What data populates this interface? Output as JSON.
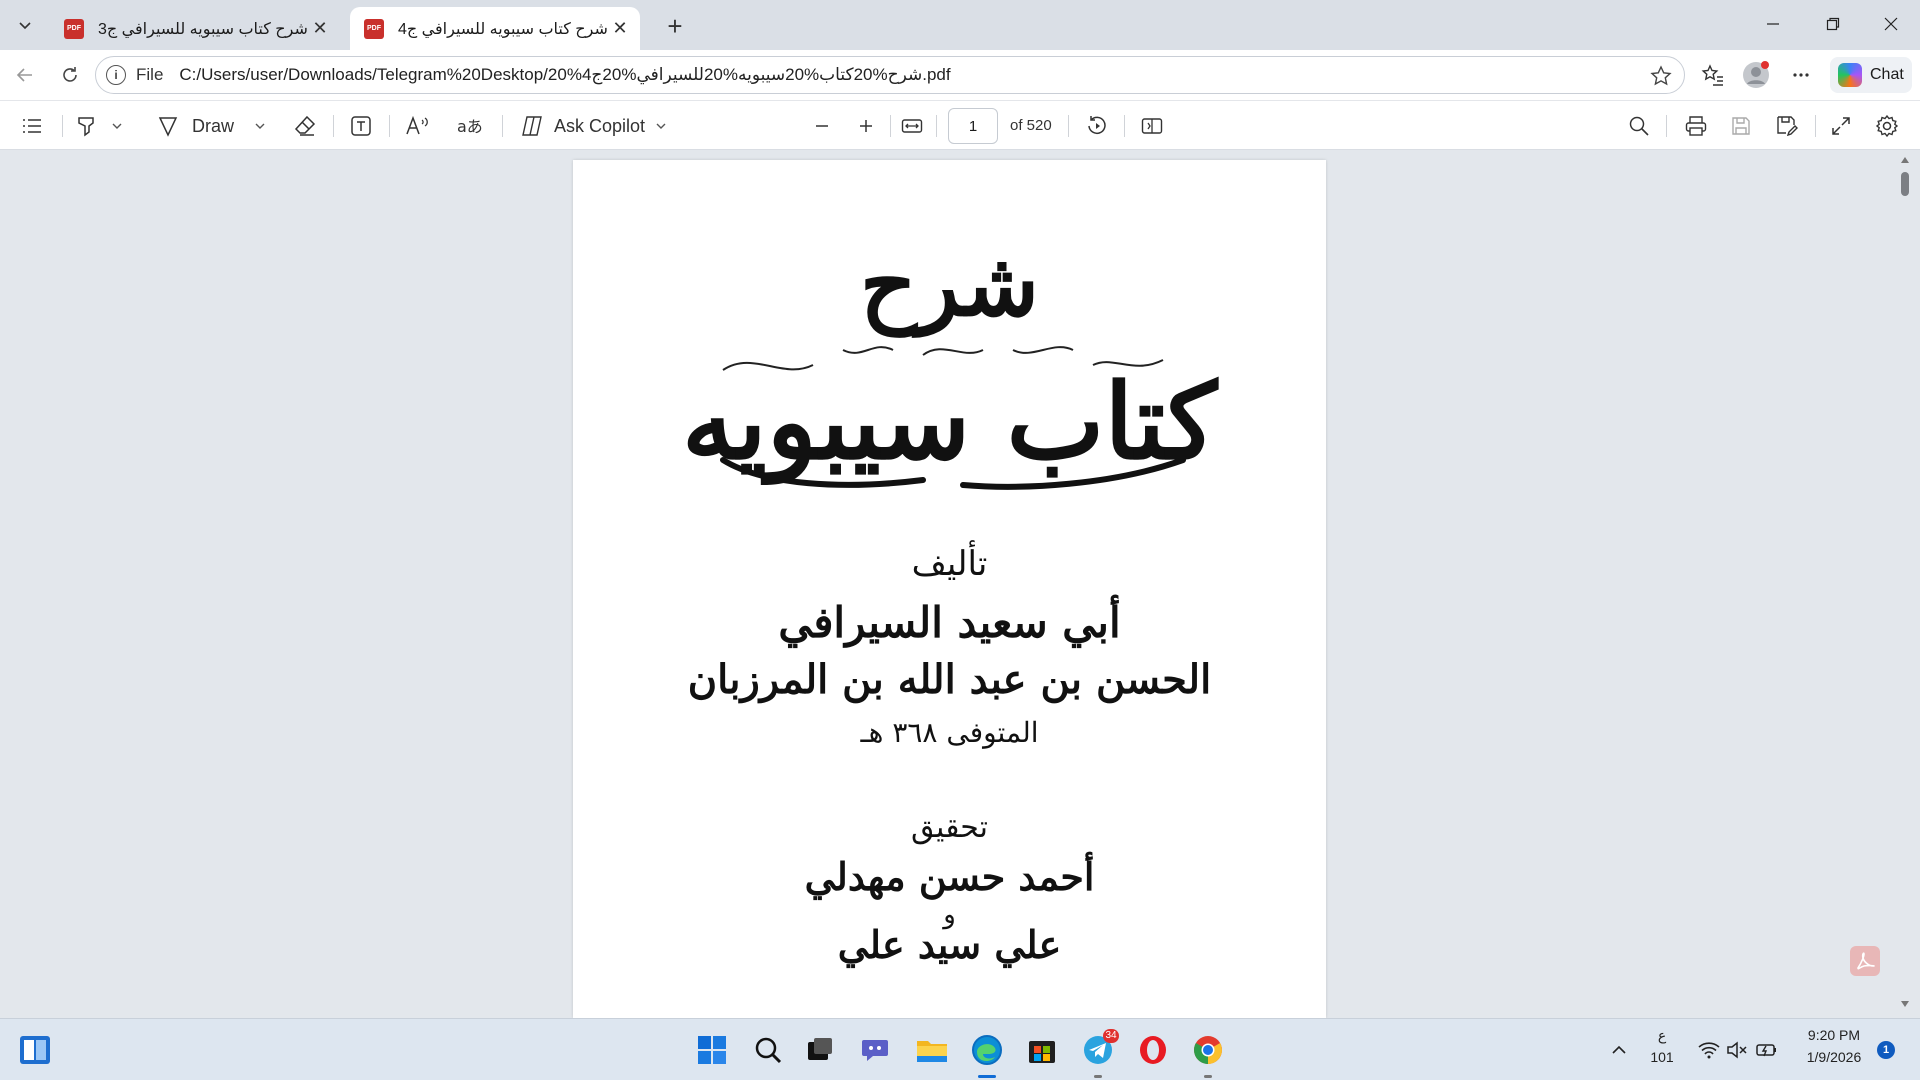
{
  "tabs": [
    {
      "title": "شرح كتاب سيبويه للسيرافي ج3 .pdf",
      "active": false,
      "icon": "pdf-icon"
    },
    {
      "title": "شرح كتاب سيبويه للسيرافي ج4 .pdf",
      "active": true,
      "icon": "pdf-icon"
    }
  ],
  "address": {
    "scheme": "File",
    "url": "C:/Users/user/Downloads/Telegram%20Desktop/شرح%20كتاب%20سيبويه%20للسيرافي%20ج4%20.pdf"
  },
  "chat_label": "Chat",
  "pdf_toolbar": {
    "draw_label": "Draw",
    "copilot_label": "Ask Copilot",
    "page_number": "1",
    "page_total": "of 520"
  },
  "document": {
    "title_line1": "شرح",
    "title_line2": "كتاب سيبويه",
    "author_intro": "تأليف",
    "author_name": "أبي سعيد السيرافي",
    "author_full": "الحسن بن عبد الله بن المرزبان",
    "death": "المتوفى ٣٦٨ هـ",
    "editors_intro": "تحقيق",
    "editor1": "أحمد حسن مهدلي",
    "conjunction": "و",
    "editor2": "علي سيد علي"
  },
  "taskbar": {
    "telegram_badge": "34",
    "keyboard_lang": "ع",
    "keyboard_code": "101",
    "time": "9:20 PM",
    "date": "1/9/2026",
    "notification_count": "1"
  }
}
